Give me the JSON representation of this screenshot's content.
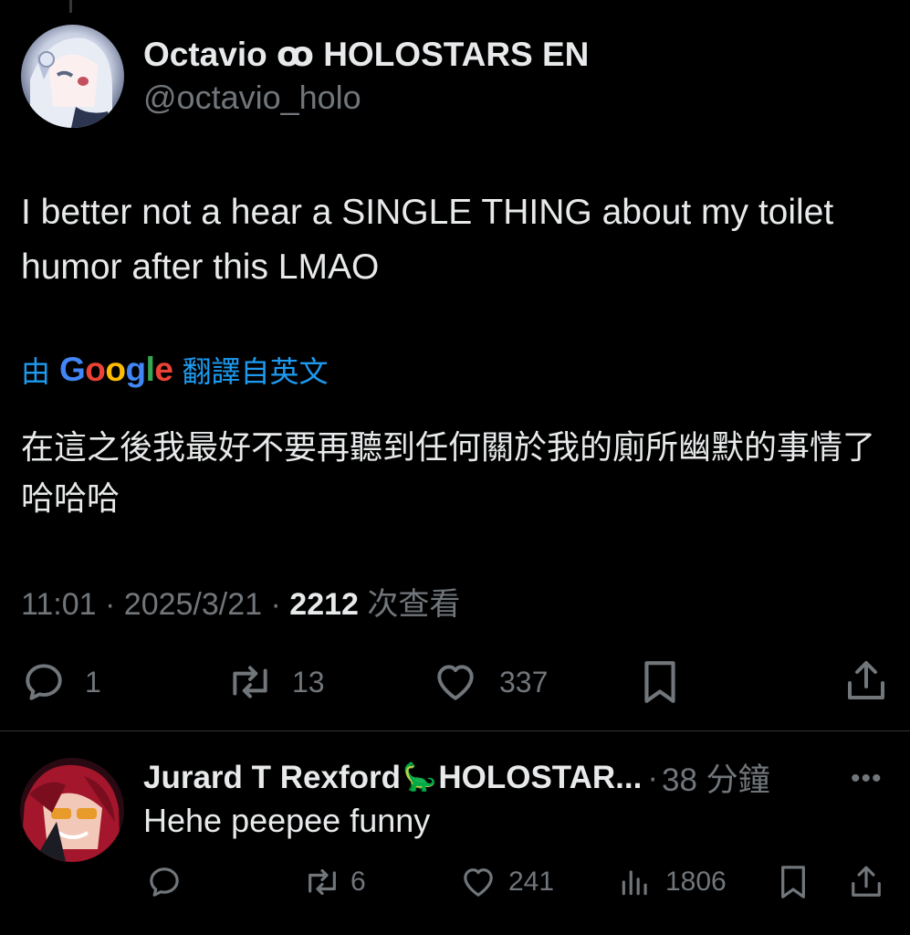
{
  "tweet": {
    "display_name": "Octavio ꝏ HOLOSTARS EN",
    "handle": "@octavio_holo",
    "text": "I better not a hear a SINGLE THING about my toilet humor after this LMAO",
    "translation": {
      "by": "由",
      "provider": "Google",
      "note": "翻譯自英文",
      "text": "在這之後我最好不要再聽到任何關於我的廁所幽默的事情了哈哈哈"
    },
    "time": "11:01",
    "date": "2025/3/21",
    "views_count": "2212",
    "views_label": "次查看",
    "stats": {
      "replies": "1",
      "reposts": "13",
      "likes": "337"
    }
  },
  "reply": {
    "display_name": "Jurard T Rexford",
    "emoji": "🦕",
    "display_name_suffix": "HOLOSTAR...",
    "time": "38 分鐘",
    "text": "Hehe peepee funny",
    "stats": {
      "replies": "",
      "reposts": "6",
      "likes": "241",
      "views": "1806"
    }
  },
  "colors": {
    "background": "#000000",
    "text_primary": "#e7e9ea",
    "text_secondary": "#71767b",
    "link": "#1d9bf0",
    "divider": "#2f3336"
  },
  "icons": {
    "reply": "reply-icon",
    "repost": "repost-icon",
    "like": "like-icon",
    "bookmark": "bookmark-icon",
    "share": "share-icon",
    "views": "views-icon",
    "more": "more-icon"
  }
}
